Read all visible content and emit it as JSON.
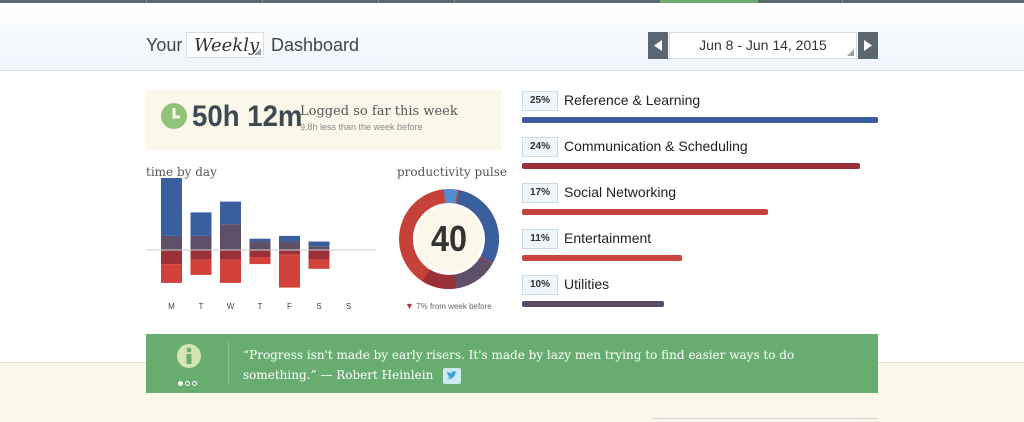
{
  "header": {
    "prefix": "Your",
    "period": "Weekly",
    "suffix": "Dashboard",
    "date_range": "Jun 8 - Jun 14, 2015"
  },
  "summary": {
    "total_time": "50h 12m",
    "caption": "Logged so far this week",
    "comparison": "9.8h less than the week before"
  },
  "time_by_day": {
    "label": "time by day"
  },
  "pulse": {
    "label": "productivity pulse",
    "value": "40",
    "change": "7% from week before"
  },
  "categories": [
    {
      "pct": "25%",
      "name": "Reference & Learning",
      "fraction": 1.0,
      "color": "#3a5f9e"
    },
    {
      "pct": "24%",
      "name": "Communication & Scheduling",
      "fraction": 0.95,
      "color": "#9b3038"
    },
    {
      "pct": "17%",
      "name": "Social Networking",
      "fraction": 0.69,
      "color": "#c5413a"
    },
    {
      "pct": "11%",
      "name": "Entertainment",
      "fraction": 0.45,
      "color": "#c9443b"
    },
    {
      "pct": "10%",
      "name": "Utilities",
      "fraction": 0.4,
      "color": "#5a4a63"
    }
  ],
  "quote": {
    "text": "“Progress isn't made by early risers. It's made by lazy men trying to find easier ways to do something.” — Robert Heinlein"
  },
  "colors": {
    "very_productive": "#3a5f9e",
    "productive": "#4f78b8",
    "neutral": "#5e5068",
    "distracting": "#9b3038",
    "very_distracting": "#d2423a",
    "accent_green": "#67ad6f"
  },
  "chart_data": {
    "type": "bar",
    "categories": [
      "M",
      "T",
      "W",
      "T",
      "F",
      "S",
      "S"
    ],
    "series": [
      {
        "values": [
          13.0,
          5.0,
          4.8,
          0.6,
          1.2,
          1.0,
          0
        ]
      },
      {
        "values": [
          3.0,
          3.0,
          5.5,
          1.8,
          1.8,
          0.8,
          0
        ]
      },
      {
        "values": [
          -3.0,
          -2.0,
          -2.0,
          -1.5,
          -1.0,
          -2.0,
          0
        ]
      },
      {
        "values": [
          -4.0,
          -3.3,
          -5.0,
          -1.5,
          -7.0,
          -2.0,
          0
        ]
      }
    ]
  }
}
